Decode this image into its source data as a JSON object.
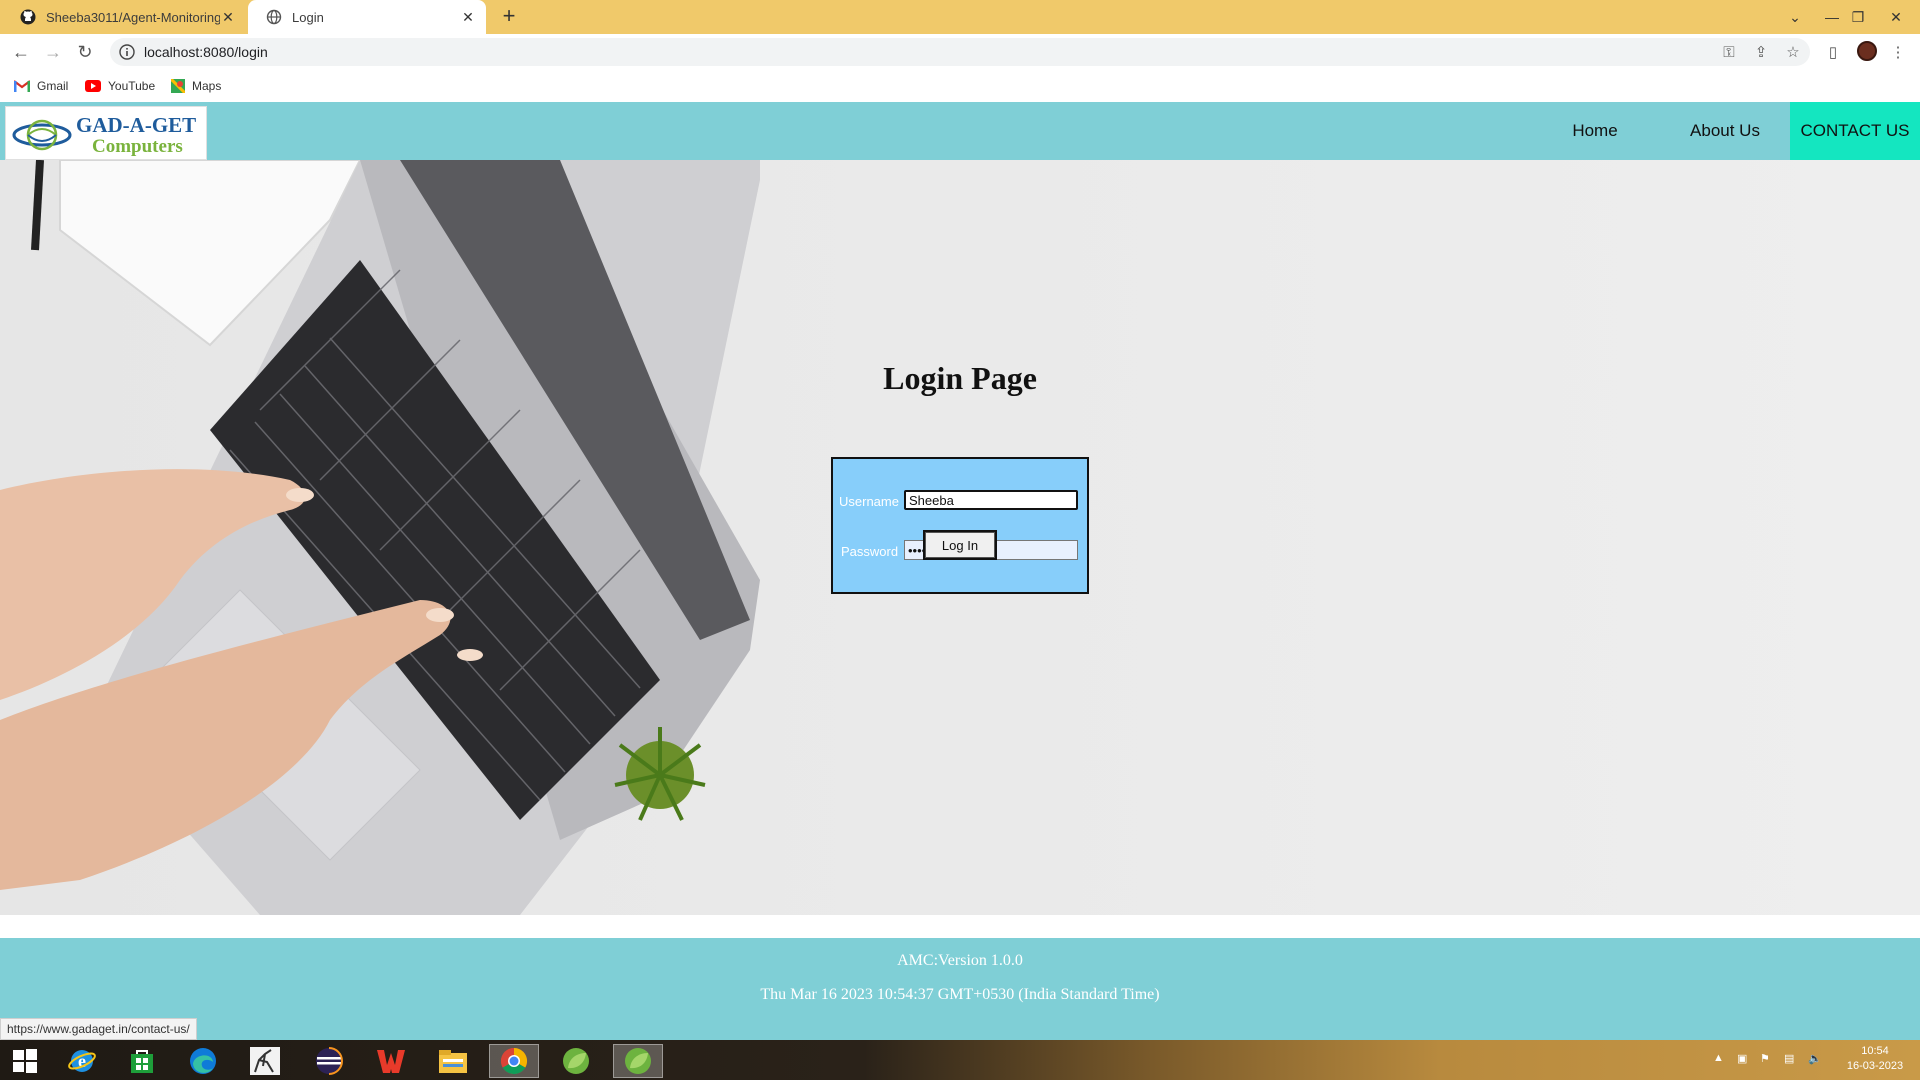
{
  "browser": {
    "tabs": [
      {
        "title": "Sheeba3011/Agent-Monitoring-",
        "active": false,
        "favicon": "github-icon"
      },
      {
        "title": "Login",
        "active": true,
        "favicon": "globe-icon"
      }
    ],
    "address": "localhost:8080/login",
    "bookmarks": [
      {
        "label": "Gmail",
        "icon": "gmail-icon"
      },
      {
        "label": "YouTube",
        "icon": "youtube-icon"
      },
      {
        "label": "Maps",
        "icon": "maps-icon"
      }
    ],
    "status_url": "https://www.gadaget.in/contact-us/"
  },
  "site": {
    "logo": {
      "line1": "GAD-A-GET",
      "line2": "Computers"
    },
    "nav": [
      {
        "label": "Home"
      },
      {
        "label": "About Us"
      },
      {
        "label": "CONTACT US"
      }
    ],
    "login": {
      "title": "Login Page",
      "username_label": "Username",
      "username_value": "Sheeba",
      "password_label": "Password",
      "password_value": "••••••••",
      "button_label": "Log In"
    },
    "footer": {
      "version": "AMC:Version 1.0.0",
      "datetime": "Thu Mar 16 2023 10:54:37 GMT+0530 (India Standard Time)"
    }
  },
  "taskbar": {
    "apps": [
      "windows-start-icon",
      "internet-explorer-icon",
      "store-icon",
      "edge-icon",
      "app-icon",
      "eclipse-icon",
      "wps-office-icon",
      "file-explorer-icon",
      "chrome-icon",
      "spring-tool-suite-icon",
      "spring-tool-suite-icon"
    ],
    "time": "10:54",
    "date": "16-03-2023"
  },
  "colors": {
    "header": "#7fcfd6",
    "contact_highlight": "#14e6c0",
    "login_box": "#87cefa",
    "tabstrip": "#f0c96a"
  }
}
